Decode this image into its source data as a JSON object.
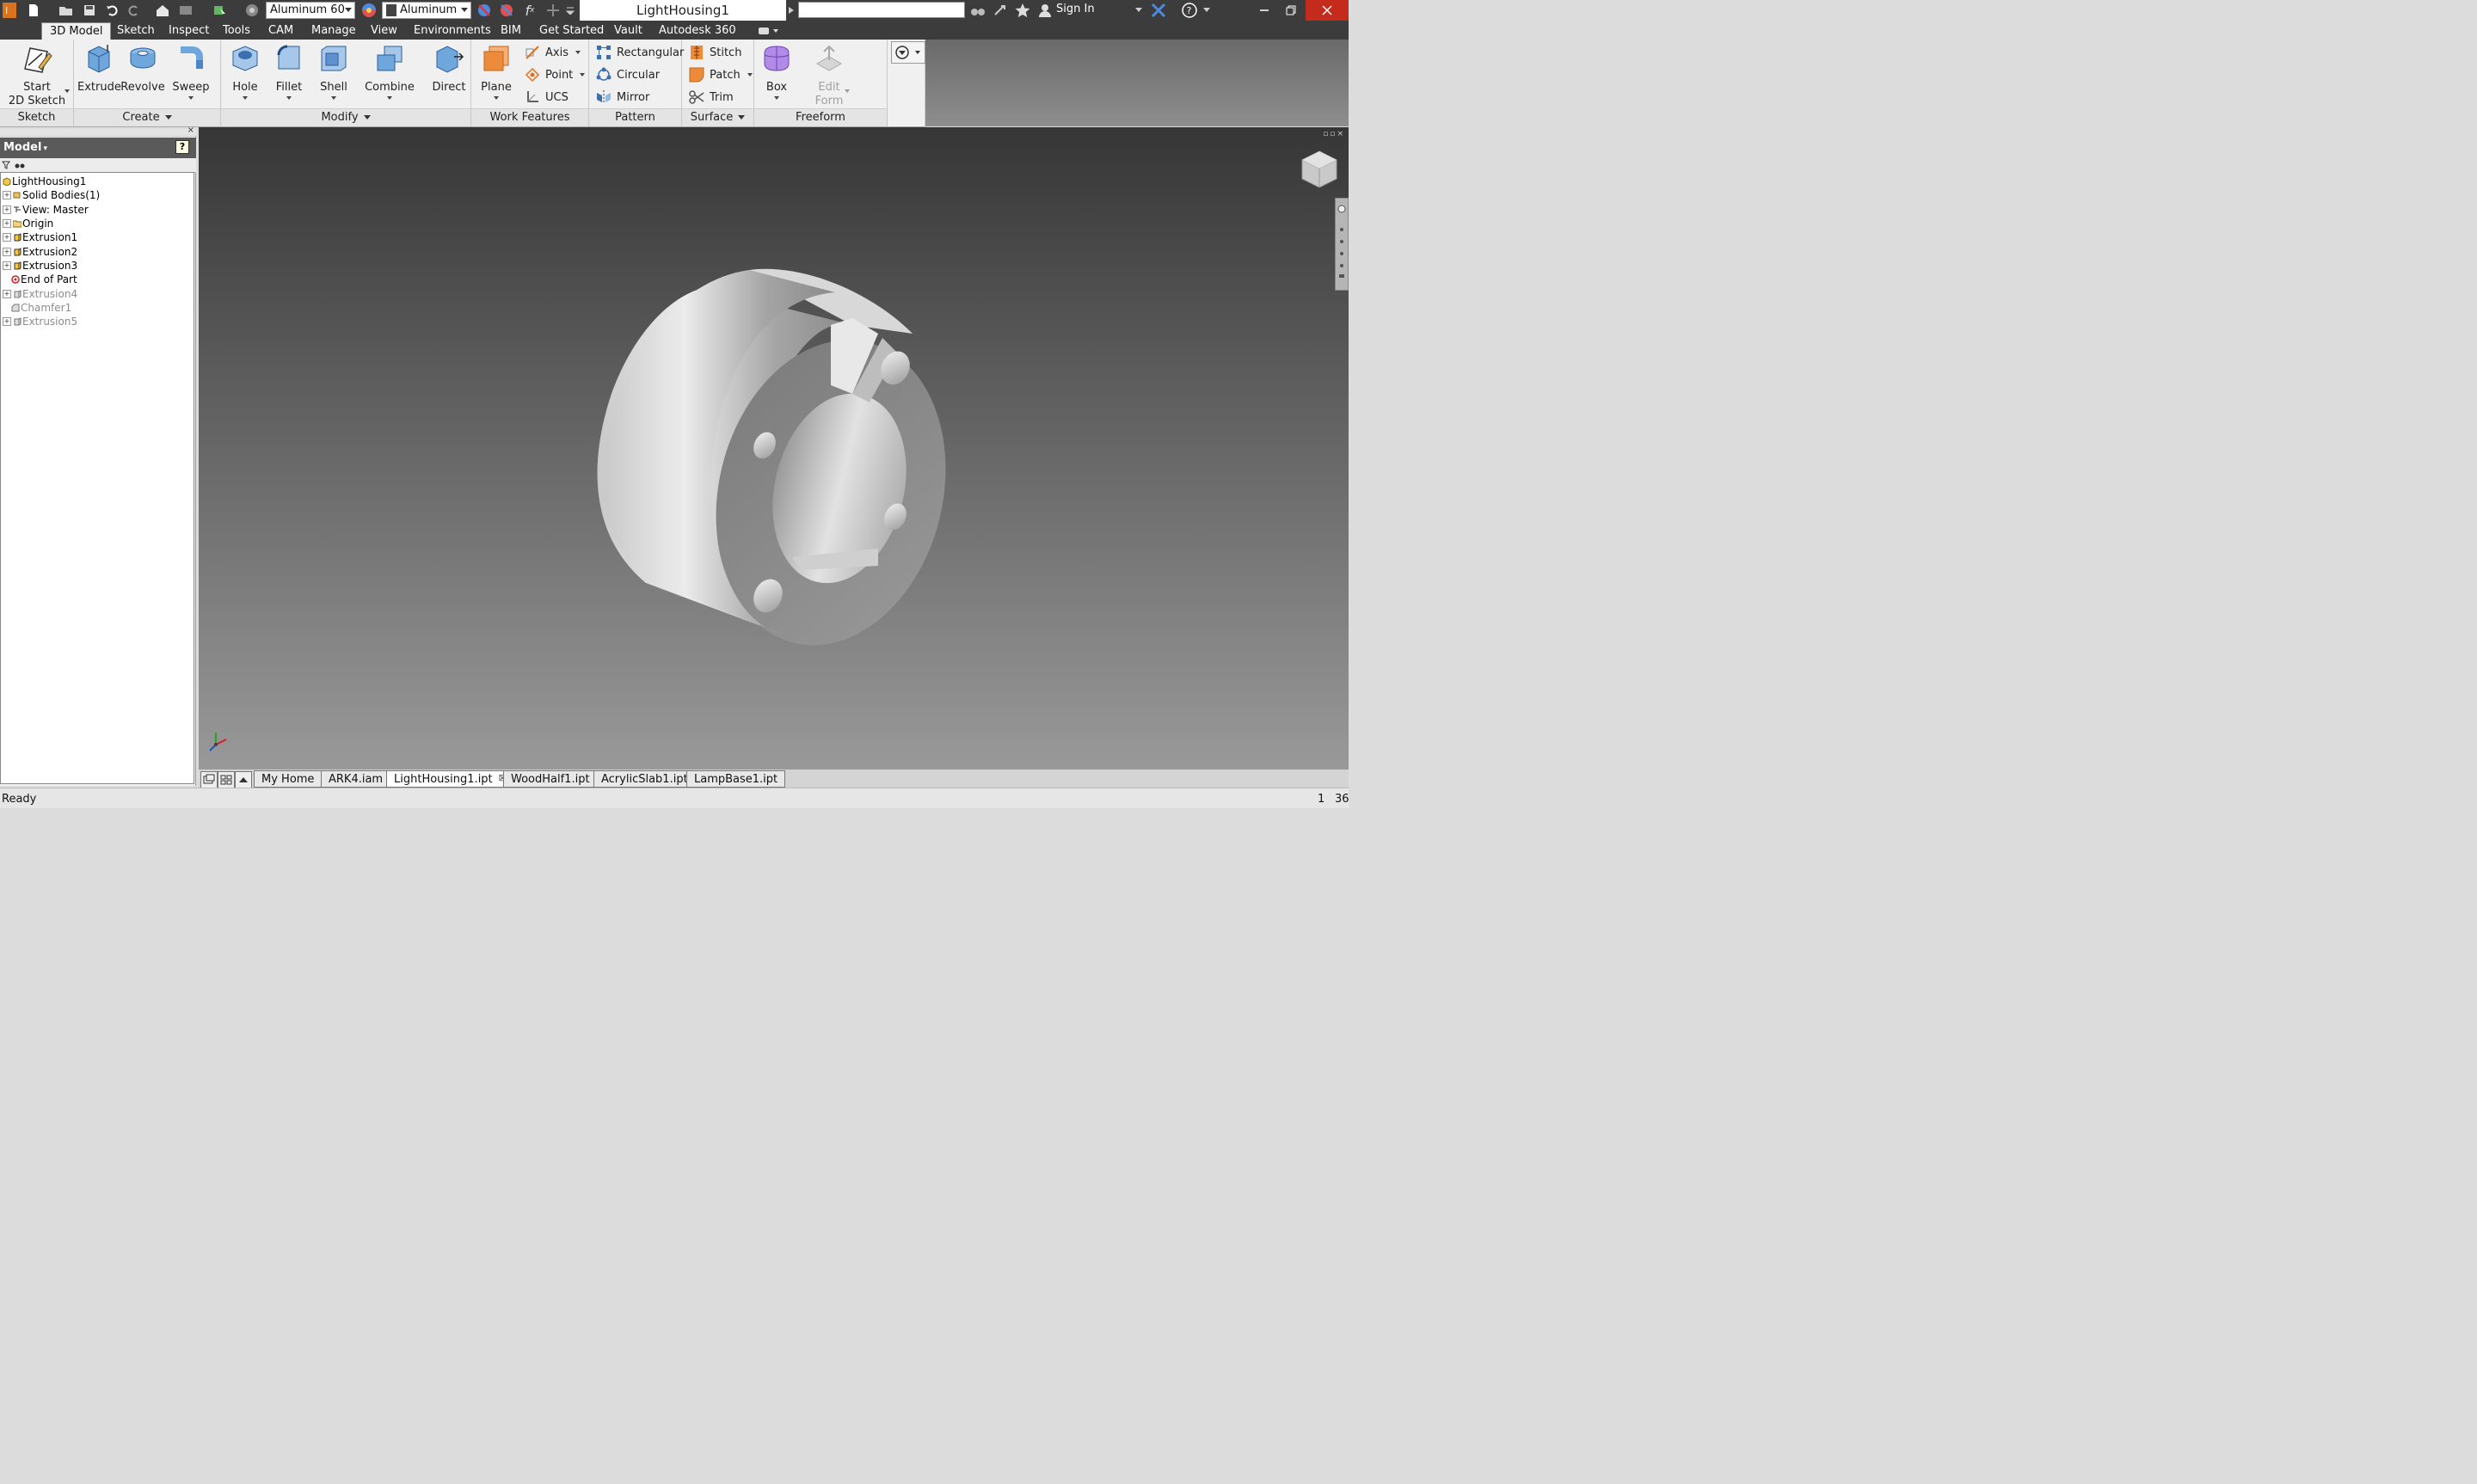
{
  "app": {
    "document_title": "LightHousing1",
    "material": "Aluminum 60",
    "appearance": "Aluminum",
    "sign_in": "Sign In",
    "fx_label": "f",
    "fx_sub": "x"
  },
  "ribbon_tabs": [
    "3D Model",
    "Sketch",
    "Inspect",
    "Tools",
    "CAM",
    "Manage",
    "View",
    "Environments",
    "BIM",
    "Get Started",
    "Vault",
    "Autodesk 360"
  ],
  "panels": {
    "sketch": {
      "title": "Sketch",
      "start_line1": "Start",
      "start_line2": "2D Sketch"
    },
    "create": {
      "title": "Create",
      "extrude": "Extrude",
      "revolve": "Revolve",
      "sweep": "Sweep"
    },
    "modify": {
      "title": "Modify",
      "hole": "Hole",
      "fillet": "Fillet",
      "shell": "Shell",
      "combine": "Combine",
      "direct": "Direct"
    },
    "work_features": {
      "title": "Work Features",
      "plane": "Plane",
      "axis": "Axis",
      "point": "Point",
      "ucs": "UCS"
    },
    "pattern": {
      "title": "Pattern",
      "rectangular": "Rectangular",
      "circular": "Circular",
      "mirror": "Mirror"
    },
    "surface": {
      "title": "Surface",
      "stitch": "Stitch",
      "patch": "Patch",
      "trim": "Trim"
    },
    "freeform": {
      "title": "Freeform",
      "box": "Box",
      "edit_line1": "Edit",
      "edit_line2": "Form"
    }
  },
  "browser": {
    "title": "Model",
    "help": "?",
    "tree": [
      {
        "label": "LightHousing1",
        "state": "root"
      },
      {
        "label": "Solid Bodies(1)",
        "state": "normal"
      },
      {
        "label": "View: Master",
        "state": "normal"
      },
      {
        "label": "Origin",
        "state": "normal"
      },
      {
        "label": "Extrusion1",
        "state": "normal"
      },
      {
        "label": "Extrusion2",
        "state": "normal"
      },
      {
        "label": "Extrusion3",
        "state": "normal"
      },
      {
        "label": "End of Part",
        "state": "eop"
      },
      {
        "label": "Extrusion4",
        "state": "suppressed"
      },
      {
        "label": "Chamfer1",
        "state": "suppressed"
      },
      {
        "label": "Extrusion5",
        "state": "suppressed"
      }
    ]
  },
  "doc_tabs": [
    "My Home",
    "ARK4.iam",
    "LightHousing1.ipt",
    "WoodHalf1.ipt",
    "AcrylicSlab1.ipt",
    "LampBase1.ipt"
  ],
  "status": {
    "text": "Ready",
    "count1": "1",
    "count2": "36"
  },
  "colors": {
    "accent": "#3c3c3c",
    "close": "#c42b1c"
  }
}
